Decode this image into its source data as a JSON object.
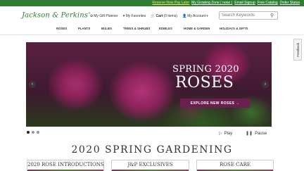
{
  "topbar": {
    "links": [
      {
        "label": "Reserve Now Pay Later",
        "highlight": true
      },
      {
        "label": "My Growing Zone ( none )",
        "highlight": false
      },
      {
        "label": "Email Signup",
        "highlight": false
      },
      {
        "label": "Free Catalog",
        "highlight": false
      },
      {
        "label": "Order Status",
        "highlight": false
      }
    ]
  },
  "header": {
    "logo": "Jackson & Perkins",
    "gift_planner": "My Gift Planner",
    "favorites": "My Favorites",
    "cart_label": "Cart",
    "cart_count": "(0 items)",
    "account": "My Account",
    "search_placeholder": "Search Keywords"
  },
  "nav": {
    "items": [
      "ROSES",
      "PLANTS",
      "BULBS",
      "TREES & SHRUBS",
      "EDIBLES",
      "HOME & GARDEN",
      "HOLIDAYS & GIFTS"
    ]
  },
  "hero": {
    "title_line1": "SPRING 2020",
    "title_line2": "ROSES",
    "cta": "EXPLORE NEW ROSES →"
  },
  "feedback": "Feedback",
  "carousel": {
    "active_slide": 1,
    "slide_count": 3,
    "play_label": "Play",
    "pause_label": "Pause"
  },
  "section": {
    "title": "2020 SPRING GARDENING",
    "cards": [
      "2020 ROSE INTRODUCTIONS",
      "J&P EXCLUSIVES",
      "ROSE CARE"
    ]
  },
  "colors": {
    "brand_green": "#2e7d32",
    "promo_yellow": "#f5e663",
    "cta_plum": "#6b1f4e"
  }
}
